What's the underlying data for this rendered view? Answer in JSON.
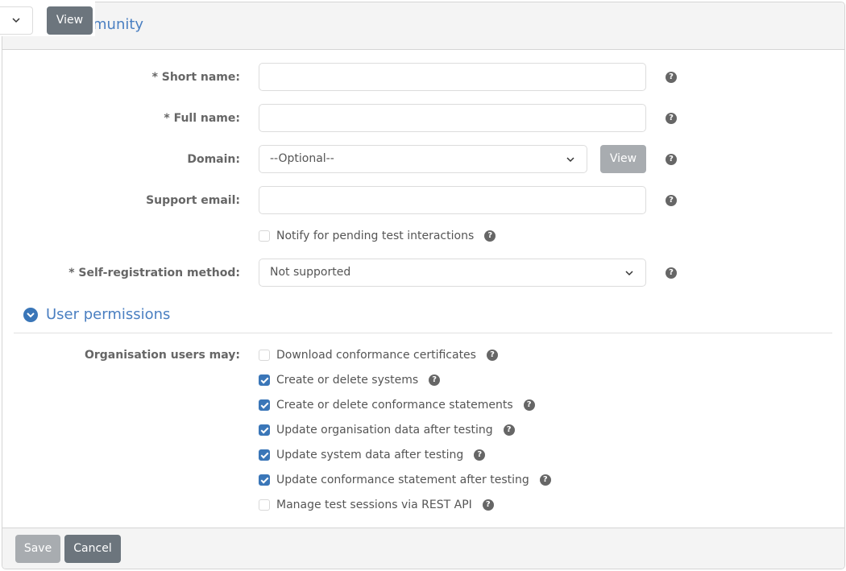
{
  "overlay": {
    "select_value": "",
    "view_button": "View"
  },
  "panel": {
    "title": "Create community",
    "title_visible_fragment": "munity"
  },
  "form": {
    "short_name": {
      "label": "* Short name:",
      "value": "",
      "help": "?"
    },
    "full_name": {
      "label": "* Full name:",
      "value": "",
      "help": "?"
    },
    "domain": {
      "label": "Domain:",
      "value": "--Optional--",
      "view_button": "View",
      "help": "?"
    },
    "support_email": {
      "label": "Support email:",
      "value": "",
      "help": "?"
    },
    "notify": {
      "label": "Notify for pending test interactions",
      "checked": false,
      "help": "?"
    },
    "self_registration": {
      "label": "* Self-registration method:",
      "value": "Not supported",
      "help": "?"
    }
  },
  "permissions": {
    "section_title": "User permissions",
    "label": "Organisation users may:",
    "items": [
      {
        "label": "Download conformance certificates",
        "checked": false
      },
      {
        "label": "Create or delete systems",
        "checked": true
      },
      {
        "label": "Create or delete conformance statements",
        "checked": true
      },
      {
        "label": "Update organisation data after testing",
        "checked": true
      },
      {
        "label": "Update system data after testing",
        "checked": true
      },
      {
        "label": "Update conformance statement after testing",
        "checked": true
      },
      {
        "label": "Manage test sessions via REST API",
        "checked": false
      }
    ],
    "help": "?"
  },
  "footer": {
    "save": "Save",
    "cancel": "Cancel"
  },
  "colors": {
    "accent": "#3a76b8",
    "title": "#4a7fc1",
    "button_secondary": "#6c757d",
    "button_disabled": "#a8acb0"
  }
}
